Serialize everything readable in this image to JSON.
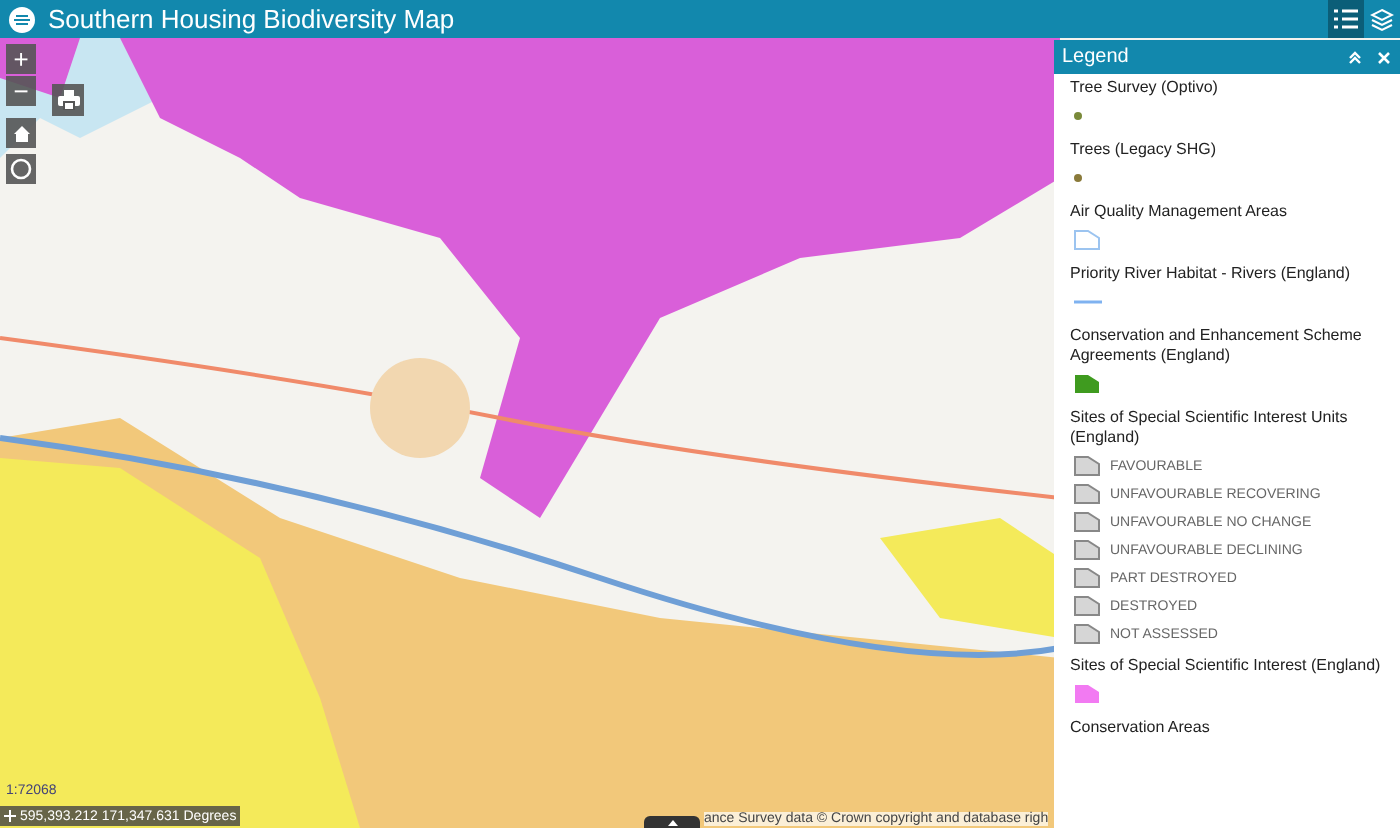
{
  "header": {
    "title": "Southern Housing Biodiversity Map",
    "tools": [
      {
        "kind": "legend",
        "selected": true
      },
      {
        "kind": "layers",
        "selected": false
      }
    ]
  },
  "map_controls": {
    "zoom_in": "+",
    "zoom_out": "−"
  },
  "legend": {
    "title": "Legend",
    "items": [
      {
        "label": "Tree Survey (Optivo)",
        "kind": "point",
        "color": "#7a8a3a"
      },
      {
        "label": "Trees (Legacy SHG)",
        "kind": "point",
        "color": "#8a7a3a"
      },
      {
        "label": "Air Quality Management Areas",
        "kind": "outline",
        "color": "#9cc4f0"
      },
      {
        "label": "Priority River Habitat - Rivers (England)",
        "kind": "line",
        "color": "#7fb2f0"
      },
      {
        "label": "Conservation and Enhancement Scheme Agreements (England)",
        "kind": "fill",
        "color": "#3f9b1f"
      },
      {
        "label": "Sites of Special Scientific Interest Units (England)",
        "kind": "group",
        "children": [
          {
            "label": "FAVOURABLE",
            "color": "#d6d6d6"
          },
          {
            "label": "UNFAVOURABLE RECOVERING",
            "color": "#d6d6d6"
          },
          {
            "label": "UNFAVOURABLE NO CHANGE",
            "color": "#d6d6d6"
          },
          {
            "label": "UNFAVOURABLE DECLINING",
            "color": "#d6d6d6"
          },
          {
            "label": "PART DESTROYED",
            "color": "#d6d6d6"
          },
          {
            "label": "DESTROYED",
            "color": "#d6d6d6"
          },
          {
            "label": "NOT ASSESSED",
            "color": "#d6d6d6"
          }
        ]
      },
      {
        "label": "Sites of Special Scientific Interest (England)",
        "kind": "fill",
        "color": "#f27af2"
      },
      {
        "label": "Conservation Areas",
        "kind": "none"
      }
    ]
  },
  "scale": "1:72068",
  "coordinates": "595,393.212 171,347.631 Degrees",
  "attribution": "ance Survey data © Crown copyright and database righ"
}
